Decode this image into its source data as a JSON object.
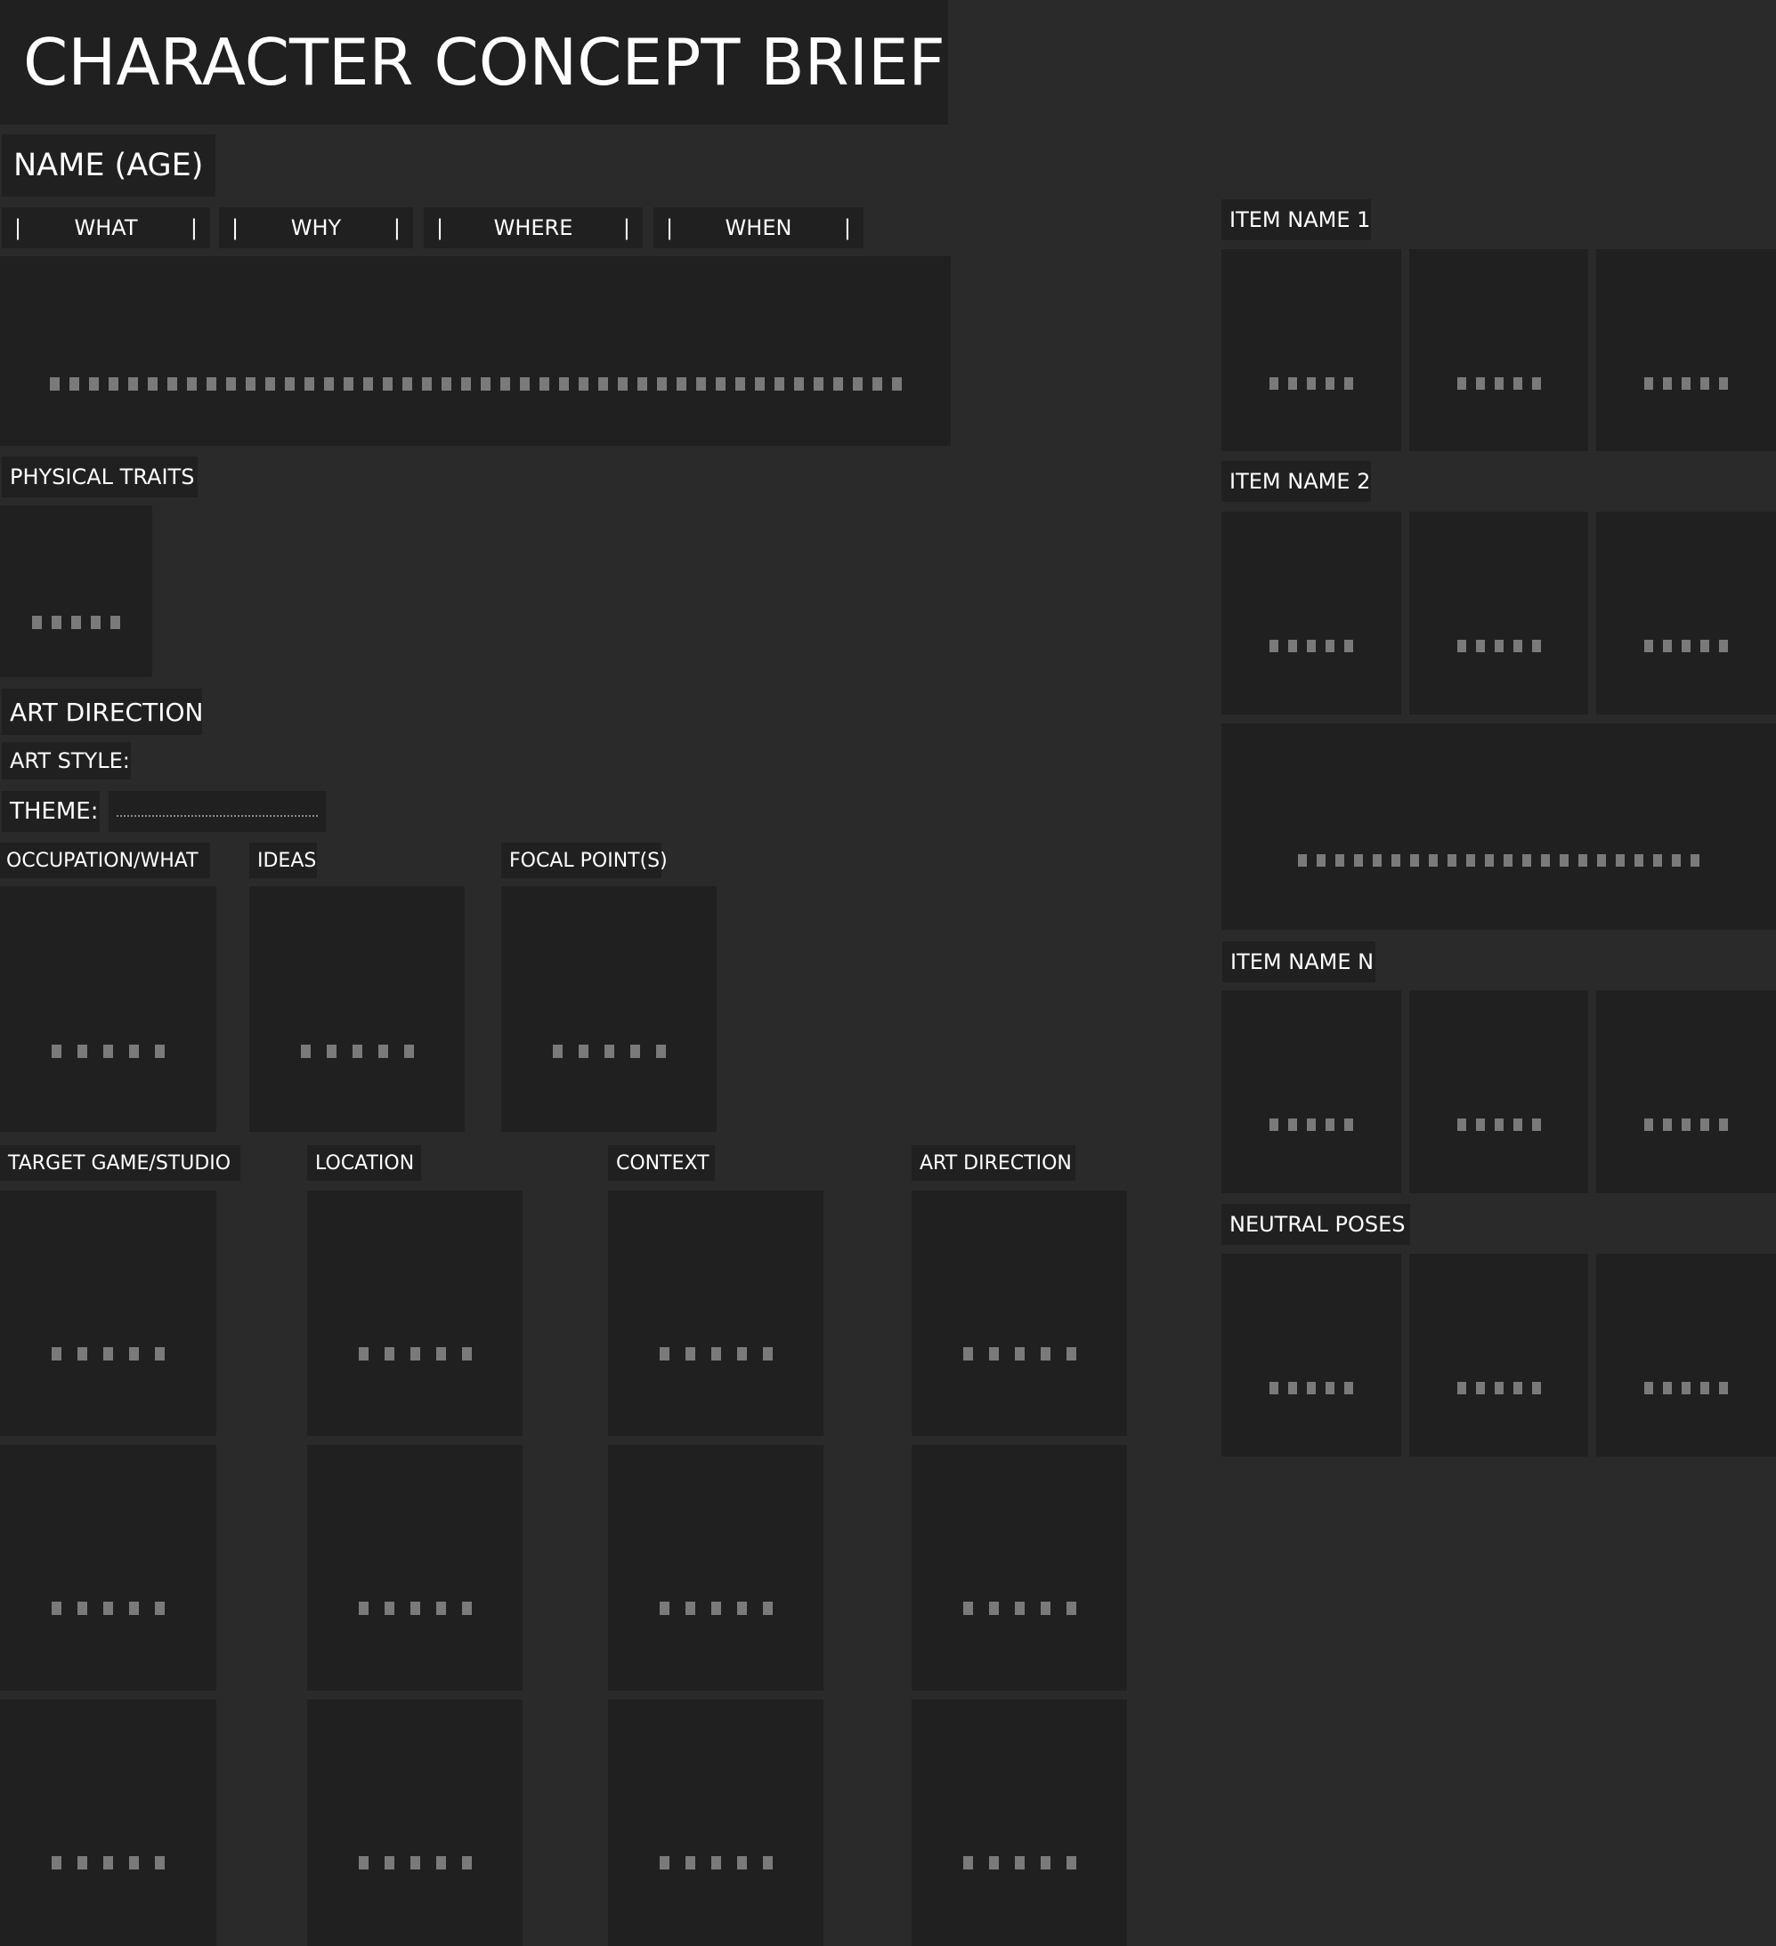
{
  "title": "CHARACTER CONCEPT BRIEF",
  "name_age": "NAME (AGE)",
  "questions": [
    {
      "pipe_l": "|",
      "label": "WHAT",
      "pipe_r": "|"
    },
    {
      "pipe_l": "|",
      "label": "WHY",
      "pipe_r": "|"
    },
    {
      "pipe_l": "|",
      "label": "WHERE",
      "pipe_r": "|"
    },
    {
      "pipe_l": "|",
      "label": "WHEN",
      "pipe_r": "|"
    }
  ],
  "physical_traits": "PHYSICAL TRAITS",
  "art_direction_heading": "ART DIRECTION",
  "art_style_label": "ART STYLE:",
  "theme_label": "THEME:",
  "reference_labels": {
    "occupation": "OCCUPATION/WHAT",
    "ideas": "IDEAS",
    "focal_points": "FOCAL POINT(S)"
  },
  "grid_labels": {
    "target": "TARGET GAME/STUDIO",
    "location": "LOCATION",
    "context": "CONTEXT",
    "art_direction": "ART DIRECTION"
  },
  "items": {
    "item1": "ITEM NAME 1",
    "item2": "ITEM NAME 2",
    "itemN": "ITEM NAME N",
    "neutral": "NEUTRAL POSES"
  },
  "colors": {
    "background": "#2a2a2a",
    "panel": "#202020",
    "placeholder": "#7a7a7a",
    "text": "#ffffff"
  }
}
